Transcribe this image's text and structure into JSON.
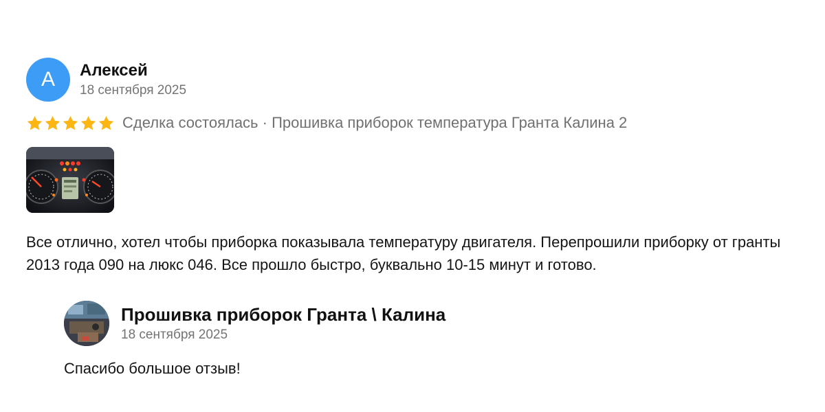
{
  "review": {
    "avatar_letter": "А",
    "avatar_color": "#3d9cf5",
    "author": "Алексей",
    "date": "18 сентября 2025",
    "rating": 5,
    "rating_max": 5,
    "star_color": "#fbb613",
    "deal_text": "Сделка состоялась · Прошивка приборок температура Гранта Калина 2",
    "text": "Все отлично, хотел чтобы приборка показывала температуру двигателя. Перепрошили приборку от гранты 2013 года 090 на люкс 046. Все прошло быстро, буквально 10-15 минут и готово."
  },
  "reply": {
    "seller_name": "Прошивка приборок Гранта \\ Калина",
    "date": "18 сентября 2025",
    "text": "Спасибо большое отзыв!"
  }
}
